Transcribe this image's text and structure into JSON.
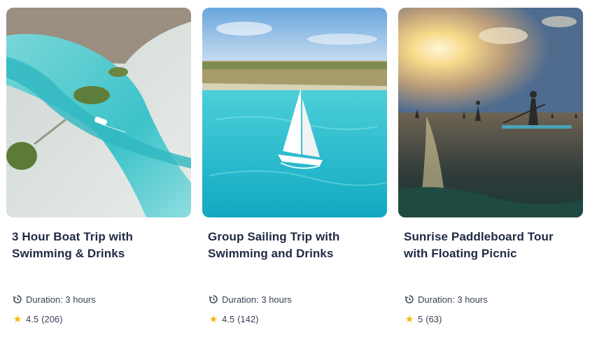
{
  "cards": [
    {
      "title": "3 Hour Boat Trip with Swimming & Drinks",
      "duration_label": "Duration: 3 hours",
      "rating": "4.5",
      "reviews": "(206)",
      "image_icon": "aerial-lagoon-boat"
    },
    {
      "title": "Group Sailing Trip with Swimming and Drinks",
      "duration_label": "Duration: 3 hours",
      "rating": "4.5",
      "reviews": "(142)",
      "image_icon": "sailboat-lagoon"
    },
    {
      "title": "Sunrise Paddleboard Tour with Floating Picnic",
      "duration_label": "Duration: 3 hours",
      "rating": "5",
      "reviews": "(63)",
      "image_icon": "paddleboard-sunrise"
    }
  ],
  "colors": {
    "title": "#1f2a44",
    "meta": "#3a4256",
    "star": "#f5b800"
  }
}
